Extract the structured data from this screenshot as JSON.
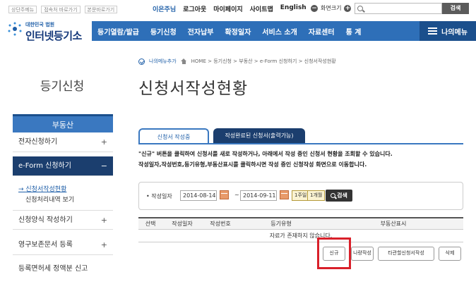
{
  "top": {
    "links": [
      "상단주메뉴",
      "접속처 바로가기",
      "본문바로가기"
    ],
    "user_links": [
      "이은주님",
      "로그아웃",
      "마이페이지",
      "사이트맵",
      "English"
    ],
    "font_size_label": "화면크기",
    "search_placeholder": "",
    "search_button": "검색"
  },
  "logo": {
    "org": "대한민국 법원",
    "name": "인터넷등기소"
  },
  "nav": {
    "items": [
      "등기열람/발급",
      "등기신청",
      "전자납부",
      "확정일자",
      "서비스 소개",
      "자료센터",
      "통 계"
    ],
    "my_menu": "나의메뉴"
  },
  "sidebar": {
    "title": "등기신청",
    "header": "부동산",
    "items": [
      "전자신청하기",
      "e-Form 신청하기",
      "신청양식 작성하기",
      "영구보존문서 등록",
      "등록면허세 정액분 신고"
    ],
    "sub_items": [
      "신청서작성현황",
      "신청처리내역 보기"
    ]
  },
  "breadcrumb": {
    "add_menu": "나의메뉴추가",
    "path": "HOME > 등기신청 > 부동산 > e-Form 신청하기 > 신청서작성현황"
  },
  "page_title": "신청서작성현황",
  "tabs": [
    "신청서 작성중",
    "작성완료된 신청서(출력가능)"
  ],
  "description": [
    "\"신규\" 버튼을 클릭하여 신청서를 새로 작성하거나, 아래에서 작성 중인 신청서 현황을 조회할 수 있습니다.",
    "작성일자,작성번호,등기유형,부동산표시를 클릭하시면 작성 중인 신청작성 화면으로 이동합니다."
  ],
  "filter": {
    "label": "• 작성일자",
    "from": "2014-08-14",
    "to": "2014-09-11",
    "period_week": "1주일",
    "period_month": "1개월",
    "search": "검색"
  },
  "table": {
    "headers": [
      "선택",
      "작성일자",
      "작성번호",
      "등기유형",
      "부동산표시"
    ],
    "empty": "자료가 존재하지 않습니다."
  },
  "actions": {
    "new": "신규",
    "order": "나량작성",
    "other": "타관할신청서작성",
    "delete": "삭제"
  },
  "colors": {
    "nav_blue": "#2e6fb8",
    "dark_navy": "#1b3e6e",
    "highlight_red": "#d9202a"
  }
}
